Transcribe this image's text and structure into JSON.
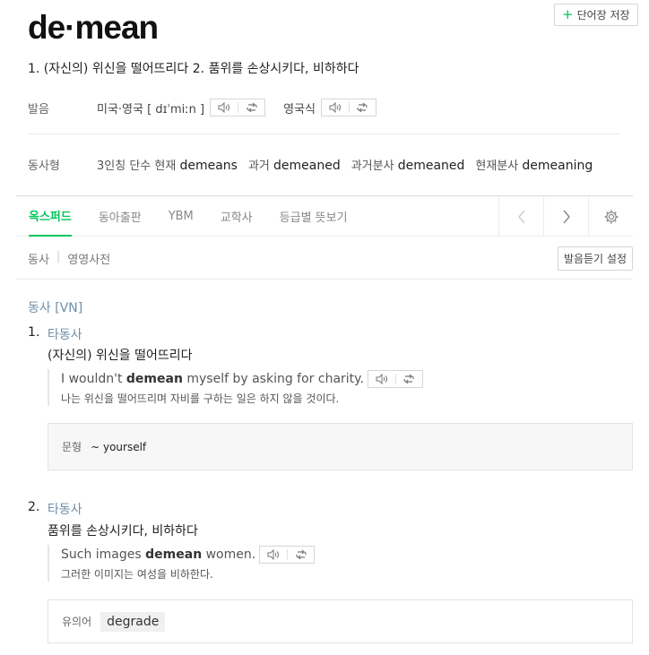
{
  "save_button": {
    "plus": "+",
    "label": "단어장 저장"
  },
  "headword": "de·mean",
  "summary": "1. (자신의) 위신을 떨어뜨리다 2. 품위를 손상시키다, 비하하다",
  "pronunciation": {
    "label": "발음",
    "us_uk_label": "미국·영국",
    "ipa": "[ dɪˈmiːn ]",
    "uk_label": "영국식"
  },
  "verb_forms": {
    "label": "동사형",
    "items": [
      {
        "label": "3인칭 단수 현재",
        "value": "demeans"
      },
      {
        "label": "과거",
        "value": "demeaned"
      },
      {
        "label": "과거분사",
        "value": "demeaned"
      },
      {
        "label": "현재분사",
        "value": "demeaning"
      }
    ]
  },
  "tabs": [
    "옥스퍼드",
    "동아출판",
    "YBM",
    "교학사",
    "등급별 뜻보기"
  ],
  "sub_tabs": {
    "first": "동사",
    "second": "영영사전"
  },
  "pron_settings_label": "발음듣기 설정",
  "pos_header": "동사 [VN]",
  "senses": [
    {
      "num": "1.",
      "pos": "타동사",
      "def": "(자신의) 위신을 떨어뜨리다",
      "ex_pre": "I wouldn't ",
      "ex_bold": "demean",
      "ex_post": " myself by asking for charity.",
      "ex_ko": "나는 위신을 떨어뜨리며 자비를 구하는 일은 하지 않을 것이다.",
      "box_label": "문형",
      "box_value": "~ yourself"
    },
    {
      "num": "2.",
      "pos": "타동사",
      "def": "품위를 손상시키다, 비하하다",
      "ex_pre": "Such images ",
      "ex_bold": "demean",
      "ex_post": " women.",
      "ex_ko": "그러한 이미지는 여성을 비하한다.",
      "box_label": "유의어",
      "box_value": "degrade"
    }
  ]
}
